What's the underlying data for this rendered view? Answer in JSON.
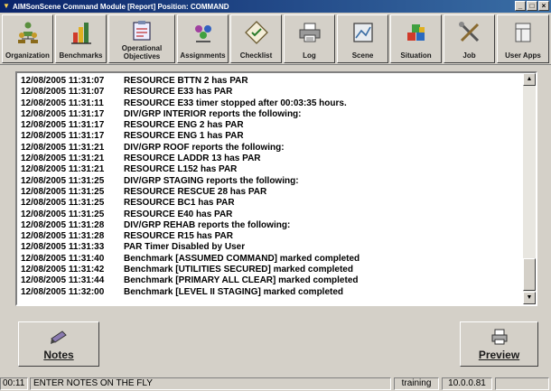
{
  "window": {
    "title": "AIMSonScene Command Module [Report] Position: COMMAND",
    "controls": [
      "_",
      "□",
      "×"
    ]
  },
  "toolbar": {
    "buttons": [
      {
        "label": "Organization",
        "icon": "people-icon"
      },
      {
        "label": "Benchmarks",
        "icon": "bar-chart-icon"
      },
      {
        "label": "Operational Objectives",
        "icon": "clipboard-icon"
      },
      {
        "label": "Assignments",
        "icon": "group-icon"
      },
      {
        "label": "Checklist",
        "icon": "checklist-icon"
      },
      {
        "label": "Log",
        "icon": "printer-icon"
      },
      {
        "label": "Scene",
        "icon": "map-icon"
      },
      {
        "label": "Situation",
        "icon": "blocks-icon"
      },
      {
        "label": "Job",
        "icon": "tools-icon"
      },
      {
        "label": "User Apps",
        "icon": "apps-icon"
      }
    ]
  },
  "log": {
    "entries": [
      {
        "time": "12/08/2005 11:31:07",
        "text": "RESOURCE BTTN 2 has PAR"
      },
      {
        "time": "12/08/2005 11:31:07",
        "text": "RESOURCE E33 has PAR"
      },
      {
        "time": "12/08/2005 11:31:11",
        "text": "RESOURCE E33 timer stopped after 00:03:35 hours."
      },
      {
        "time": "12/08/2005 11:31:17",
        "text": "DIV/GRP INTERIOR reports the following:"
      },
      {
        "time": "12/08/2005 11:31:17",
        "text": "RESOURCE ENG 2 has PAR"
      },
      {
        "time": "12/08/2005 11:31:17",
        "text": "RESOURCE ENG 1 has PAR"
      },
      {
        "time": "12/08/2005 11:31:21",
        "text": "DIV/GRP ROOF reports the following:"
      },
      {
        "time": "12/08/2005 11:31:21",
        "text": "RESOURCE LADDR 13 has PAR"
      },
      {
        "time": "12/08/2005 11:31:21",
        "text": "RESOURCE L152 has PAR"
      },
      {
        "time": "12/08/2005 11:31:25",
        "text": "DIV/GRP STAGING reports the following:"
      },
      {
        "time": "12/08/2005 11:31:25",
        "text": "RESOURCE RESCUE 28 has PAR"
      },
      {
        "time": "12/08/2005 11:31:25",
        "text": "RESOURCE BC1 has PAR"
      },
      {
        "time": "12/08/2005 11:31:25",
        "text": "RESOURCE E40 has PAR"
      },
      {
        "time": "12/08/2005 11:31:28",
        "text": "DIV/GRP REHAB reports the following:"
      },
      {
        "time": "12/08/2005 11:31:28",
        "text": "RESOURCE R15 has PAR"
      },
      {
        "time": "12/08/2005 11:31:33",
        "text": "PAR Timer Disabled by User"
      },
      {
        "time": "12/08/2005 11:31:40",
        "text": "Benchmark [ASSUMED COMMAND] marked completed"
      },
      {
        "time": "12/08/2005 11:31:42",
        "text": "Benchmark [UTILITIES SECURED] marked completed"
      },
      {
        "time": "12/08/2005 11:31:44",
        "text": "Benchmark [PRIMARY ALL CLEAR] marked completed"
      },
      {
        "time": "12/08/2005 11:32:00",
        "text": "Benchmark [LEVEL II STAGING] marked completed"
      }
    ]
  },
  "actions": {
    "notes_label": "Notes",
    "preview_label": "Preview"
  },
  "status": {
    "timer": "00:11",
    "message": "ENTER NOTES ON THE FLY",
    "mode": "training",
    "version": "10.0.0.81"
  },
  "colors": {
    "titlebar": "#0a246a",
    "face": "#d4d0c8",
    "panel": "#ffffff"
  }
}
